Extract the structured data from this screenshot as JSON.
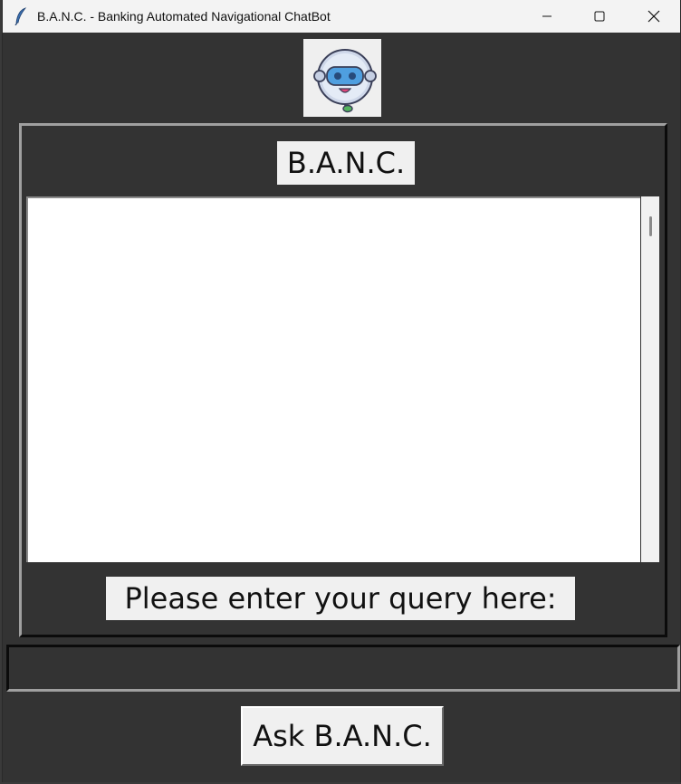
{
  "window": {
    "title": "B.A.N.C. - Banking Automated Navigational ChatBot",
    "controls": [
      "minimize-icon",
      "maximize-icon",
      "close-icon"
    ]
  },
  "logo": {
    "icon": "robot-icon"
  },
  "chat": {
    "title": "B.A.N.C.",
    "messages": [],
    "prompt_label": "Please enter your query here:"
  },
  "query": {
    "value": "",
    "placeholder": ""
  },
  "ask_button": {
    "label": "Ask B.A.N.C."
  },
  "colors": {
    "window_bg": "#333333",
    "label_bg": "#f0f0f0",
    "chat_bg": "#ffffff",
    "titlebar_bg": "#f3f3f3"
  }
}
